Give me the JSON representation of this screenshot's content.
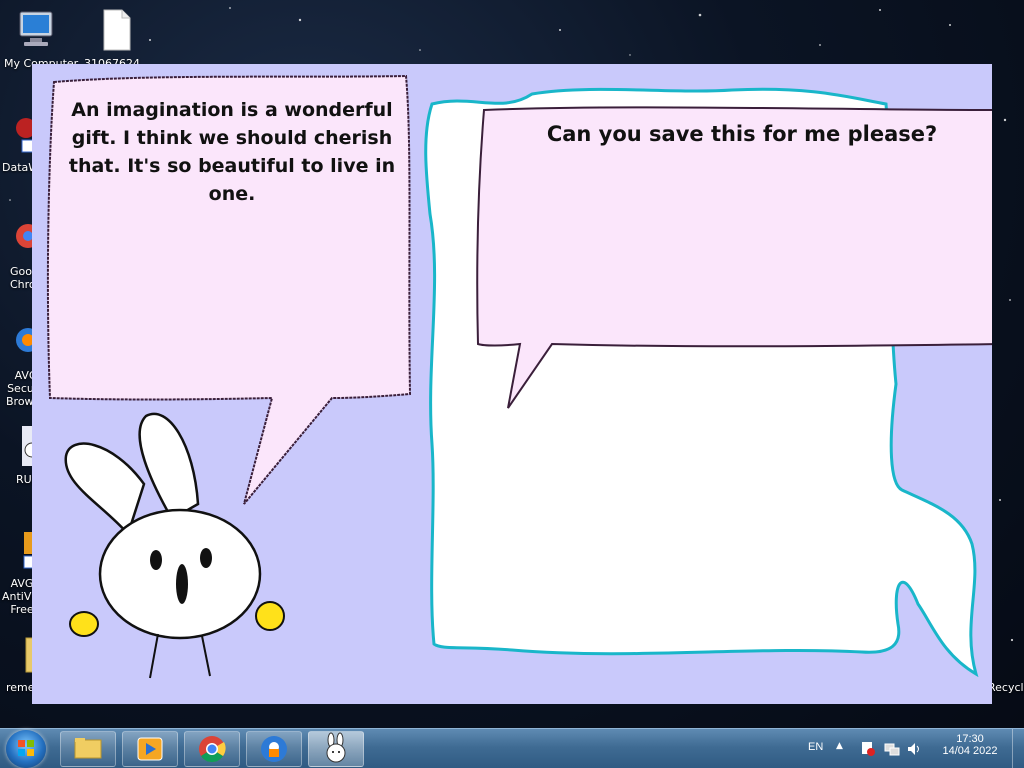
{
  "desktop": {
    "icons": [
      {
        "label": "My Computer"
      },
      {
        "label": "31067624..."
      },
      {
        "label": "DataW..."
      },
      {
        "label": "Google Chrome"
      },
      {
        "label": "AVG Secure Browser"
      },
      {
        "label": "RUN"
      },
      {
        "label": "AVG AntiVirus Free"
      },
      {
        "label": "remember"
      },
      {
        "label": "Recycle Bin"
      }
    ]
  },
  "app": {
    "left_bubble_text": "An imagination is a wonderful gift. I think we should cherish that. It's so beautiful to live in one.",
    "right_bubble_text": "Can you save this for me please?"
  },
  "taskbar": {
    "language": "EN",
    "time": "17:30",
    "date": "14/04 2022",
    "programs": [
      "Windows Explorer",
      "Media Player",
      "Google Chrome",
      "AVG Secure Browser",
      "Bunny App"
    ]
  },
  "colors": {
    "app_background": "#c9c9fb",
    "bubble_pink": "#fbe6fb",
    "cloud_white": "#ffffff",
    "cloud_outline": "#19b6c9",
    "bunny_hands": "#ffe11a"
  }
}
